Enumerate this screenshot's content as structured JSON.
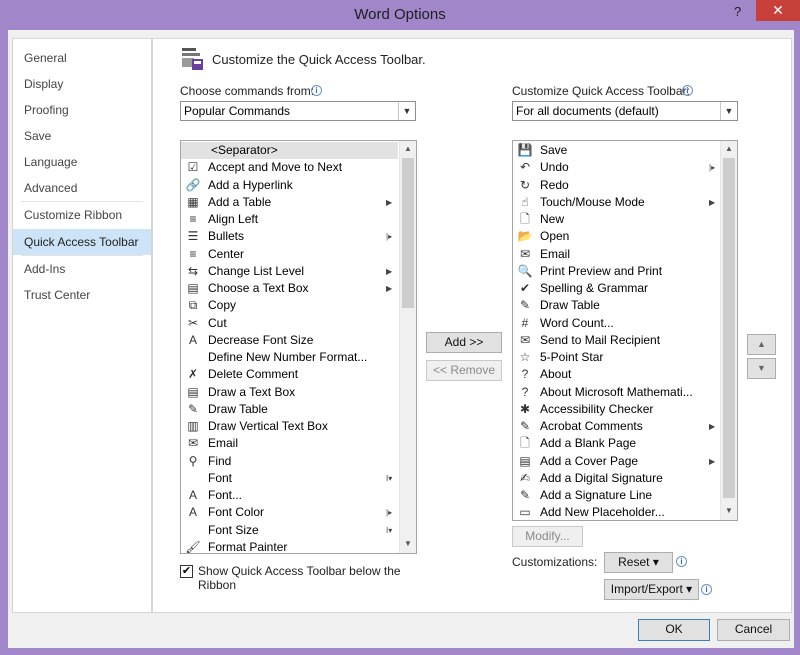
{
  "window": {
    "title": "Word Options",
    "help_icon": "?",
    "close_icon": "✕"
  },
  "nav": {
    "items": [
      {
        "label": "General"
      },
      {
        "label": "Display"
      },
      {
        "label": "Proofing"
      },
      {
        "label": "Save"
      },
      {
        "label": "Language"
      },
      {
        "label": "Advanced"
      },
      {
        "label": "Customize Ribbon"
      },
      {
        "label": "Quick Access Toolbar",
        "selected": true
      },
      {
        "label": "Add-Ins"
      },
      {
        "label": "Trust Center"
      }
    ]
  },
  "main": {
    "heading": "Customize the Quick Access Toolbar.",
    "choose_label": "Choose commands from:",
    "choose_value": "Popular Commands",
    "customize_label": "Customize Quick Access Toolbar:",
    "customize_value": "For all documents (default)",
    "left_list": [
      {
        "icon": "",
        "label": "<Separator>"
      },
      {
        "icon": "accept-move-next-icon",
        "glyph": "☑",
        "label": "Accept and Move to Next"
      },
      {
        "icon": "hyperlink-icon",
        "glyph": "🔗",
        "label": "Add a Hyperlink"
      },
      {
        "icon": "table-icon",
        "glyph": "▦",
        "label": "Add a Table",
        "sub": "▶"
      },
      {
        "icon": "align-left-icon",
        "glyph": "≡",
        "label": "Align Left"
      },
      {
        "icon": "bullets-icon",
        "glyph": "☰",
        "label": "Bullets",
        "sub": "|▸"
      },
      {
        "icon": "center-icon",
        "glyph": "≡",
        "label": "Center"
      },
      {
        "icon": "list-level-icon",
        "glyph": "⇆",
        "label": "Change List Level",
        "sub": "▶"
      },
      {
        "icon": "text-box-icon",
        "glyph": "▤",
        "label": "Choose a Text Box",
        "sub": "▶"
      },
      {
        "icon": "copy-icon",
        "glyph": "⧉",
        "label": "Copy"
      },
      {
        "icon": "cut-icon",
        "glyph": "✂",
        "label": "Cut"
      },
      {
        "icon": "decrease-font-icon",
        "glyph": "A",
        "label": "Decrease Font Size"
      },
      {
        "icon": "",
        "glyph": "",
        "label": "Define New Number Format..."
      },
      {
        "icon": "delete-comment-icon",
        "glyph": "✗",
        "label": "Delete Comment"
      },
      {
        "icon": "draw-text-box-icon",
        "glyph": "▤",
        "label": "Draw a Text Box"
      },
      {
        "icon": "draw-table-icon",
        "glyph": "✎",
        "label": "Draw Table"
      },
      {
        "icon": "vertical-text-box-icon",
        "glyph": "▥",
        "label": "Draw Vertical Text Box"
      },
      {
        "icon": "email-icon",
        "glyph": "✉",
        "label": "Email"
      },
      {
        "icon": "find-icon",
        "glyph": "⚲",
        "label": "Find"
      },
      {
        "icon": "",
        "glyph": "",
        "label": "Font",
        "sub": "I▾"
      },
      {
        "icon": "font-icon",
        "glyph": "A",
        "label": "Font..."
      },
      {
        "icon": "font-color-icon",
        "glyph": "A",
        "label": "Font Color",
        "sub": "|▸"
      },
      {
        "icon": "",
        "glyph": "",
        "label": "Font Size",
        "sub": "I▾"
      },
      {
        "icon": "format-painter-icon",
        "glyph": "🖌",
        "label": "Format Painter"
      }
    ],
    "right_list": [
      {
        "icon": "save-icon",
        "glyph": "💾",
        "label": "Save"
      },
      {
        "icon": "undo-icon",
        "glyph": "↶",
        "label": "Undo",
        "sub": "|▸"
      },
      {
        "icon": "redo-icon",
        "glyph": "↻",
        "label": "Redo"
      },
      {
        "icon": "touch-mouse-icon",
        "glyph": "☝",
        "label": "Touch/Mouse Mode",
        "sub": "▶"
      },
      {
        "icon": "new-icon",
        "glyph": "🗋",
        "label": "New"
      },
      {
        "icon": "open-icon",
        "glyph": "📂",
        "label": "Open"
      },
      {
        "icon": "email-icon",
        "glyph": "✉",
        "label": "Email"
      },
      {
        "icon": "print-preview-icon",
        "glyph": "🔍",
        "label": "Print Preview and Print"
      },
      {
        "icon": "spelling-icon",
        "glyph": "✔",
        "label": "Spelling & Grammar"
      },
      {
        "icon": "draw-table-icon",
        "glyph": "✎",
        "label": "Draw Table"
      },
      {
        "icon": "word-count-icon",
        "glyph": "#",
        "label": "Word Count..."
      },
      {
        "icon": "mail-recipient-icon",
        "glyph": "✉",
        "label": "Send to Mail Recipient"
      },
      {
        "icon": "star-icon",
        "glyph": "☆",
        "label": "5-Point Star"
      },
      {
        "icon": "about-icon",
        "glyph": "?",
        "label": "About"
      },
      {
        "icon": "about-math-icon",
        "glyph": "?",
        "label": "About Microsoft Mathemati..."
      },
      {
        "icon": "accessibility-icon",
        "glyph": "✱",
        "label": "Accessibility Checker"
      },
      {
        "icon": "acrobat-icon",
        "glyph": "✎",
        "label": "Acrobat Comments",
        "sub": "▶"
      },
      {
        "icon": "blank-page-icon",
        "glyph": "🗋",
        "label": "Add a Blank Page"
      },
      {
        "icon": "cover-page-icon",
        "glyph": "▤",
        "label": "Add a Cover Page",
        "sub": "▶"
      },
      {
        "icon": "digital-signature-icon",
        "glyph": "✍",
        "label": "Add a Digital Signature"
      },
      {
        "icon": "signature-line-icon",
        "glyph": "✎",
        "label": "Add a Signature Line"
      },
      {
        "icon": "placeholder-icon",
        "glyph": "▭",
        "label": "Add New Placeholder..."
      }
    ],
    "add_button": "Add >>",
    "remove_button": "<< Remove",
    "move_up": "▲",
    "move_down": "▼",
    "modify_button": "Modify...",
    "customizations_label": "Customizations:",
    "reset_button": "Reset ▾",
    "import_export_button": "Import/Export ▾",
    "show_below_label": "Show Quick Access Toolbar below the Ribbon",
    "show_below_checked": true
  },
  "footer": {
    "ok": "OK",
    "cancel": "Cancel"
  }
}
